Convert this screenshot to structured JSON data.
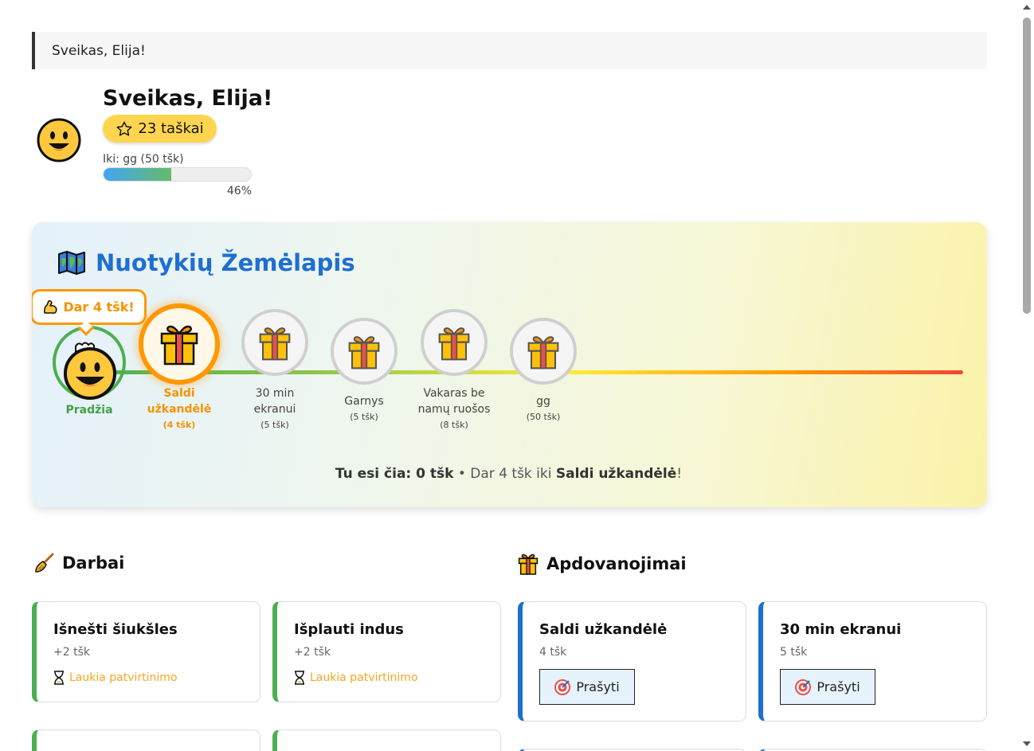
{
  "greeting_bar": "Sveikas, Elija!",
  "profile": {
    "name": "Sveikas, Elija!",
    "points_label": "23 taškai",
    "goal_label": "Iki: gg (50 tšk)",
    "progress_percent": 46,
    "progress_label": "46%"
  },
  "map": {
    "title": "Nuotykių Žemėlapis",
    "bubble": "Dar 4 tšk!",
    "start_label": "Pradžia",
    "nodes": [
      {
        "line1": "Saldi",
        "line2": "užkandėlė",
        "pts": "(4 tšk)"
      },
      {
        "line1": "30 min",
        "line2": "ekranui",
        "pts": "(5 tšk)"
      },
      {
        "line1": "Garnys",
        "line2": "",
        "pts": "(5 tšk)"
      },
      {
        "line1": "Vakaras be",
        "line2": "namų ruošos",
        "pts": "(8 tšk)"
      },
      {
        "line1": "gg",
        "line2": "",
        "pts": "(50 tšk)"
      }
    ],
    "footer": {
      "you_are_here": "Tu esi čia: 0 tšk",
      "separator": " • Dar 4 tšk iki ",
      "next_reward": "Saldi užkandėlė",
      "end": "!"
    }
  },
  "chores": {
    "title": "Darbai",
    "items": [
      {
        "title": "Išnešti šiukšles",
        "points": "+2 tšk",
        "status": "Laukia patvirtinimo"
      },
      {
        "title": "Išplauti indus",
        "points": "+2 tšk",
        "status": "Laukia patvirtinimo"
      }
    ]
  },
  "rewards": {
    "title": "Apdovanojimai",
    "items": [
      {
        "title": "Saldi užkandėlė",
        "points": "4 tšk",
        "button": "Prašyti"
      },
      {
        "title": "30 min ekranui",
        "points": "5 tšk",
        "button": "Prašyti"
      }
    ]
  },
  "colors": {
    "accent_blue": "#1e6fd0",
    "chore_green": "#4caf50",
    "pending_orange": "#f5a623",
    "points_yellow": "#ffd54f"
  }
}
